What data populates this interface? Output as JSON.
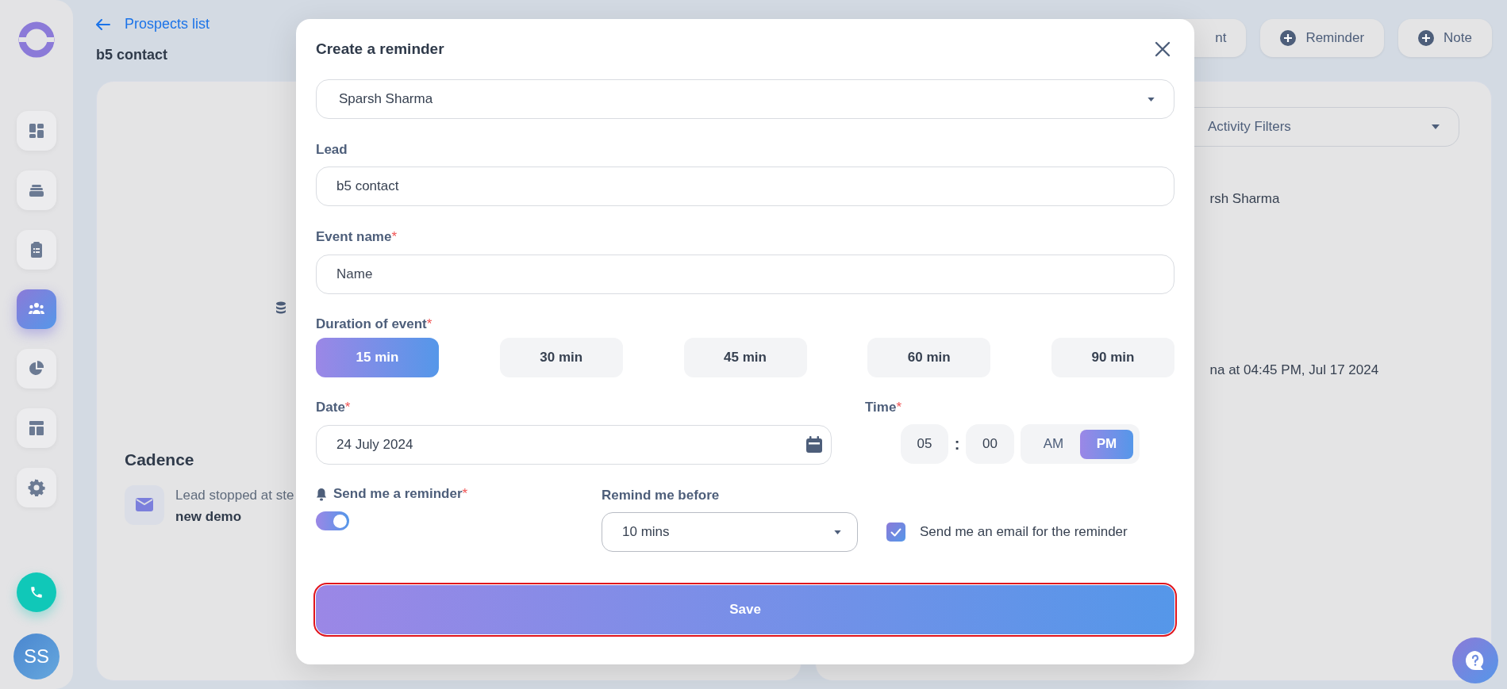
{
  "sidebar": {
    "items": [
      {
        "kind": "dashboard",
        "selected": false
      },
      {
        "kind": "stack",
        "selected": false
      },
      {
        "kind": "clipboard",
        "selected": false
      },
      {
        "kind": "people",
        "selected": true
      },
      {
        "kind": "pie",
        "selected": false
      },
      {
        "kind": "layout",
        "selected": false
      },
      {
        "kind": "gear",
        "selected": false
      }
    ],
    "avatar": "SS"
  },
  "header": {
    "back_link": "Prospects list",
    "title": "b5 contact",
    "actions": [
      {
        "label": "nt",
        "icon": false
      },
      {
        "label": "Reminder",
        "icon": true
      },
      {
        "label": "Note",
        "icon": true
      }
    ]
  },
  "left_card": {
    "cadence_title": "Cadence",
    "cadence_text": "Lead stopped at ste",
    "cadence_subtext": "new demo"
  },
  "right_card": {
    "filter": "Activity Filters",
    "lines": [
      "rsh Sharma",
      "na at 04:45 PM, Jul 17 2024"
    ]
  },
  "modal": {
    "title": "Create a reminder",
    "required_mark": "*",
    "contact": "Sparsh Sharma",
    "lead": {
      "label": "Lead",
      "value": "b5 contact",
      "required": false
    },
    "event_name": {
      "label": "Event name",
      "placeholder": "Name",
      "required": true
    },
    "duration": {
      "label": "Duration of event",
      "required": true,
      "options": [
        {
          "label": "15 min",
          "selected": true
        },
        {
          "label": "30 min",
          "selected": false
        },
        {
          "label": "45 min",
          "selected": false
        },
        {
          "label": "60 min",
          "selected": false
        },
        {
          "label": "90 min",
          "selected": false
        }
      ]
    },
    "date": {
      "label": "Date",
      "value": "24 July 2024",
      "required": true
    },
    "time": {
      "label": "Time",
      "required": true,
      "hour": "05",
      "separator": ":",
      "minute": "00",
      "periods": [
        {
          "label": "AM",
          "selected": false
        },
        {
          "label": "PM",
          "selected": true
        }
      ]
    },
    "send_reminder": {
      "label": "Send me a reminder",
      "required": true,
      "on": true
    },
    "remind_before": {
      "label": "Remind me before",
      "value": "10 mins"
    },
    "email": {
      "label": "Send me an email for the reminder",
      "checked": true
    },
    "save": "Save"
  }
}
